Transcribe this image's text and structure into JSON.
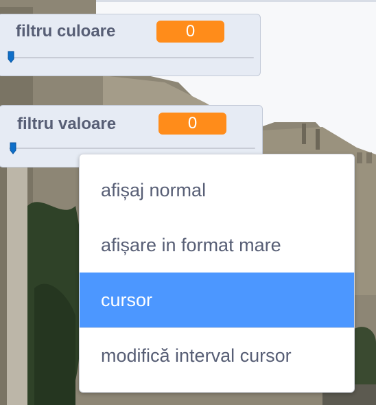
{
  "monitors": [
    {
      "label": "filtru culoare",
      "value": "0",
      "slider_fraction": 0
    },
    {
      "label": "filtru valoare",
      "value": "0",
      "slider_fraction": 0
    }
  ],
  "context_menu": {
    "items": [
      {
        "label": "afișaj normal",
        "selected": false
      },
      {
        "label": "afișare in format mare",
        "selected": false
      },
      {
        "label": "cursor",
        "selected": true
      },
      {
        "label": "modifică interval cursor",
        "selected": false
      }
    ]
  },
  "colors": {
    "value_badge": "#ff8c1a",
    "selected_item": "#4c97ff",
    "label_text": "#575e75",
    "slider_thumb": "#0f6fc9"
  },
  "icons": {
    "slider_handle": "slider-thumb-icon"
  }
}
